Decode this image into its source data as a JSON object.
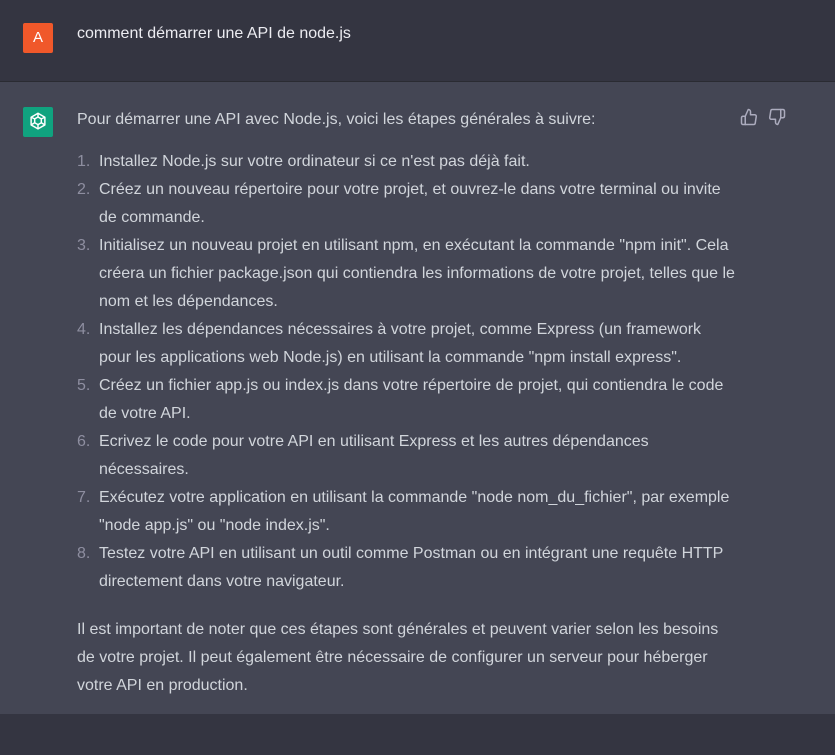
{
  "user": {
    "avatar_letter": "A",
    "message": "comment démarrer une API de node.js"
  },
  "assistant": {
    "intro": "Pour démarrer une API avec Node.js, voici les étapes générales à suivre:",
    "steps": [
      {
        "num": "1.",
        "text": "Installez Node.js sur votre ordinateur si ce n'est pas déjà fait."
      },
      {
        "num": "2.",
        "text": "Créez un nouveau répertoire pour votre projet, et ouvrez-le dans votre terminal ou invite de commande."
      },
      {
        "num": "3.",
        "text": "Initialisez un nouveau projet en utilisant npm, en exécutant la commande \"npm init\". Cela créera un fichier package.json qui contiendra les informations de votre projet, telles que le nom et les dépendances."
      },
      {
        "num": "4.",
        "text": "Installez les dépendances nécessaires à votre projet, comme Express (un framework pour les applications web Node.js) en utilisant la commande \"npm install express\"."
      },
      {
        "num": "5.",
        "text": "Créez un fichier app.js ou index.js dans votre répertoire de projet, qui contiendra le code de votre API."
      },
      {
        "num": "6.",
        "text": "Ecrivez le code pour votre API en utilisant Express et les autres dépendances nécessaires."
      },
      {
        "num": "7.",
        "text": "Exécutez votre application en utilisant la commande \"node nom_du_fichier\", par exemple \"node app.js\" ou \"node index.js\"."
      },
      {
        "num": "8.",
        "text": "Testez votre API en utilisant un outil comme Postman ou en intégrant une requête HTTP directement dans votre navigateur."
      }
    ],
    "outro": "Il est important de noter que ces étapes sont générales et peuvent varier selon les besoins de votre projet. Il peut également être nécessaire de configurer un serveur pour héberger votre API en production."
  },
  "icons": {
    "user_avatar": "user-avatar-icon",
    "assistant_avatar": "openai-logo-icon",
    "like": "thumbs-up-icon",
    "dislike": "thumbs-down-icon"
  },
  "colors": {
    "user_avatar_bg": "#f0582a",
    "assistant_avatar_bg": "#10a37f",
    "user_row_bg": "#343541",
    "assistant_row_bg": "#444654"
  }
}
